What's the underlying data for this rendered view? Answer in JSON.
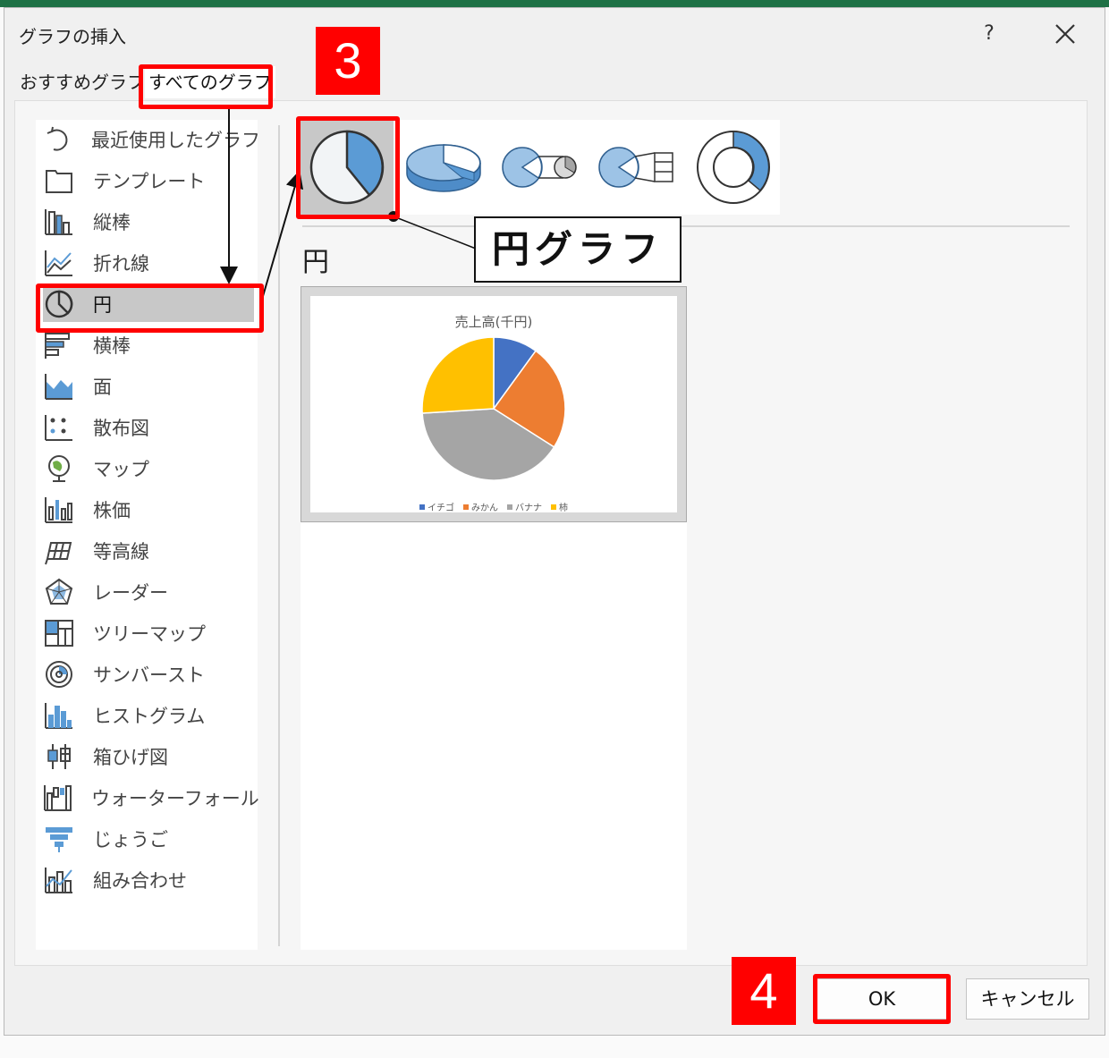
{
  "dialog": {
    "title": "グラフの挿入",
    "help_label": "?",
    "tabs": [
      {
        "label": "おすすめグラフ",
        "active": false
      },
      {
        "label": "すべてのグラフ",
        "active": true
      }
    ]
  },
  "chart_types": [
    {
      "label": "最近使用したグラフ",
      "icon": "recent-icon"
    },
    {
      "label": "テンプレート",
      "icon": "folder-icon"
    },
    {
      "label": "縦棒",
      "icon": "column-chart-icon"
    },
    {
      "label": "折れ線",
      "icon": "line-chart-icon"
    },
    {
      "label": "円",
      "icon": "pie-chart-icon",
      "selected": true
    },
    {
      "label": "横棒",
      "icon": "bar-chart-icon"
    },
    {
      "label": "面",
      "icon": "area-chart-icon"
    },
    {
      "label": "散布図",
      "icon": "scatter-chart-icon"
    },
    {
      "label": "マップ",
      "icon": "map-chart-icon"
    },
    {
      "label": "株価",
      "icon": "stock-chart-icon"
    },
    {
      "label": "等高線",
      "icon": "surface-chart-icon"
    },
    {
      "label": "レーダー",
      "icon": "radar-chart-icon"
    },
    {
      "label": "ツリーマップ",
      "icon": "treemap-chart-icon"
    },
    {
      "label": "サンバースト",
      "icon": "sunburst-chart-icon"
    },
    {
      "label": "ヒストグラム",
      "icon": "histogram-chart-icon"
    },
    {
      "label": "箱ひげ図",
      "icon": "box-whisker-chart-icon"
    },
    {
      "label": "ウォーターフォール",
      "icon": "waterfall-chart-icon"
    },
    {
      "label": "じょうご",
      "icon": "funnel-chart-icon"
    },
    {
      "label": "組み合わせ",
      "icon": "combo-chart-icon"
    }
  ],
  "subtypes": [
    {
      "icon": "pie-2d-icon",
      "selected": true
    },
    {
      "icon": "pie-3d-icon"
    },
    {
      "icon": "pie-of-pie-icon"
    },
    {
      "icon": "bar-of-pie-icon"
    },
    {
      "icon": "doughnut-icon"
    }
  ],
  "group_title": "円",
  "preview": {
    "chart_data": {
      "type": "pie",
      "title": "売上高(千円)",
      "categories": [
        "イチゴ",
        "みかん",
        "バナナ",
        "柿"
      ],
      "values": [
        10,
        24,
        40,
        26
      ],
      "colors": [
        "#4472c4",
        "#ed7d31",
        "#a5a5a5",
        "#ffc000"
      ],
      "legend": "bottom"
    }
  },
  "buttons": {
    "ok": "OK",
    "cancel": "キャンセル"
  },
  "annotations": {
    "step3": "3",
    "step4": "4",
    "callout": "円グラフ"
  },
  "colors": {
    "accent_blue": "#5b9bd5",
    "annotation_red": "#ff0000"
  }
}
